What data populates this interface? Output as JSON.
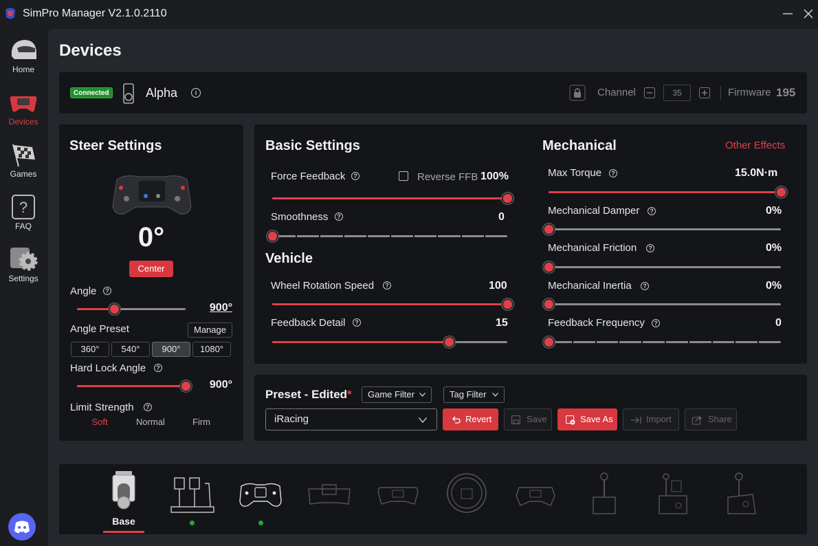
{
  "app": {
    "title": "SimPro Manager V2.1.0.2110"
  },
  "sidebar": {
    "items": [
      {
        "label": "Home",
        "icon": "helmet-icon",
        "active": false
      },
      {
        "label": "Devices",
        "icon": "steering-wheel-icon",
        "active": true
      },
      {
        "label": "Games",
        "icon": "checkered-flag-icon",
        "active": false
      },
      {
        "label": "FAQ",
        "icon": "question-icon",
        "active": false
      },
      {
        "label": "Settings",
        "icon": "gear-icon",
        "active": false
      }
    ]
  },
  "page": {
    "title": "Devices"
  },
  "device": {
    "status": "Connected",
    "name": "Alpha",
    "channel_label": "Channel",
    "channel_value": "35",
    "firmware_label": "Firmware",
    "firmware_value": "195"
  },
  "steer": {
    "title": "Steer Settings",
    "angle_display": "0°",
    "center_label": "Center",
    "angle_label": "Angle",
    "angle_value": "900°",
    "angle_fraction": 0.34,
    "preset_label": "Angle Preset",
    "manage_label": "Manage",
    "presets": [
      "360°",
      "540°",
      "900°",
      "1080°"
    ],
    "selected_preset": "900°",
    "hard_lock_label": "Hard Lock Angle",
    "hard_lock_value": "900°",
    "hard_lock_fraction": 1.0,
    "limit_strength_label": "Limit Strength",
    "limit_options": [
      "Soft",
      "Normal",
      "Firm"
    ],
    "limit_selected": "Soft"
  },
  "basic": {
    "title": "Basic Settings",
    "ffb_label": "Force Feedback",
    "reverse_label": "Reverse FFB",
    "ffb_value": "100%",
    "ffb_fraction": 1.0,
    "smooth_label": "Smoothness",
    "smooth_value": "0",
    "smooth_fraction": 0.0
  },
  "vehicle": {
    "title": "Vehicle",
    "wrs_label": "Wheel Rotation Speed",
    "wrs_value": "100",
    "wrs_fraction": 1.0,
    "detail_label": "Feedback Detail",
    "detail_value": "15",
    "detail_fraction": 0.75
  },
  "mechanical": {
    "title": "Mechanical",
    "other_label": "Other Effects",
    "torque_label": "Max Torque",
    "torque_value": "15.0N·m",
    "torque_fraction": 1.0,
    "damper_label": "Mechanical Damper",
    "damper_value": "0%",
    "friction_label": "Mechanical Friction",
    "friction_value": "0%",
    "inertia_label": "Mechanical Inertia",
    "inertia_value": "0%",
    "freq_label": "Feedback Frequency",
    "freq_value": "0"
  },
  "preset": {
    "title": "Preset - Edited",
    "asterisk": "*",
    "game_filter": "Game Filter",
    "tag_filter": "Tag Filter",
    "selected": "iRacing",
    "revert": "Revert",
    "save": "Save",
    "save_as": "Save As",
    "import": "Import",
    "share": "Share"
  },
  "device_tabs": {
    "base_label": "Base"
  },
  "colors": {
    "accent": "#e0404a",
    "connected": "#1f8f2e",
    "panel": "#141518",
    "background": "#24272c"
  }
}
